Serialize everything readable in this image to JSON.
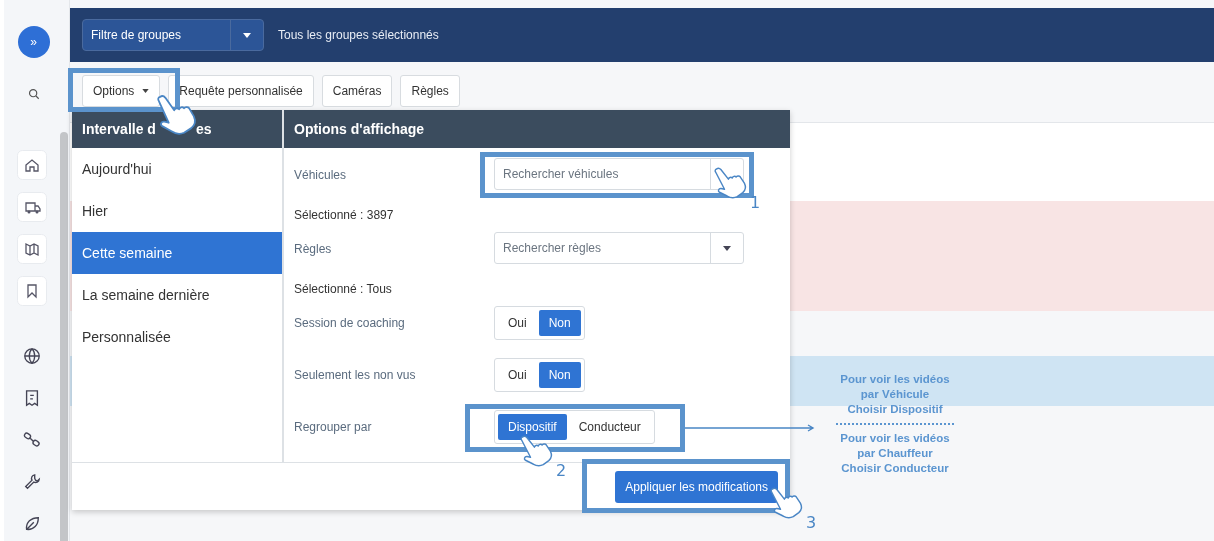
{
  "sidebar": {
    "toggle": "»"
  },
  "group_filter": {
    "label": "Filtre de groupes",
    "summary": "Tous les groupes sélectionnés"
  },
  "toolbar": [
    {
      "label": "Options",
      "caret": true
    },
    {
      "label": "Requête personnalisée",
      "caret": false
    },
    {
      "label": "Caméras",
      "caret": false
    },
    {
      "label": "Règles",
      "caret": false
    }
  ],
  "options_panel": {
    "date_range": {
      "title_start": "Intervalle d",
      "title_end": "es",
      "items": [
        {
          "label": "Aujourd'hui",
          "selected": false
        },
        {
          "label": "Hier",
          "selected": false
        },
        {
          "label": "Cette semaine",
          "selected": true
        },
        {
          "label": "La semaine dernière",
          "selected": false
        },
        {
          "label": "Personnalisée",
          "selected": false
        }
      ]
    },
    "display": {
      "title": "Options d'affichage",
      "rows": [
        {
          "kind": "select",
          "label": "Véhicules",
          "placeholder": "Rechercher véhicules",
          "caret": false,
          "note": "Sélectionné : 3897"
        },
        {
          "kind": "select",
          "label": "Règles",
          "placeholder": "Rechercher règles",
          "caret": true,
          "note": "Sélectionné : Tous"
        },
        {
          "kind": "toggle",
          "label": "Session de coaching",
          "options": [
            {
              "label": "Oui",
              "selected": false
            },
            {
              "label": "Non",
              "selected": true
            }
          ]
        },
        {
          "kind": "toggle",
          "label": "Seulement les non vus",
          "options": [
            {
              "label": "Oui",
              "selected": false
            },
            {
              "label": "Non",
              "selected": true
            }
          ]
        },
        {
          "kind": "toggle",
          "label": "Regrouper par",
          "options": [
            {
              "label": "Dispositif",
              "selected": true
            },
            {
              "label": "Conducteur",
              "selected": false
            }
          ]
        }
      ]
    },
    "apply": "Appliquer les modifications"
  },
  "markers": [
    "1",
    "2",
    "3"
  ],
  "note": {
    "first": [
      "Pour voir les vidéos",
      "par Véhicule",
      "Choisir Dispositif"
    ],
    "second": [
      "Pour voir les vidéos",
      "par Chauffeur",
      "Choisir Conducteur"
    ]
  }
}
